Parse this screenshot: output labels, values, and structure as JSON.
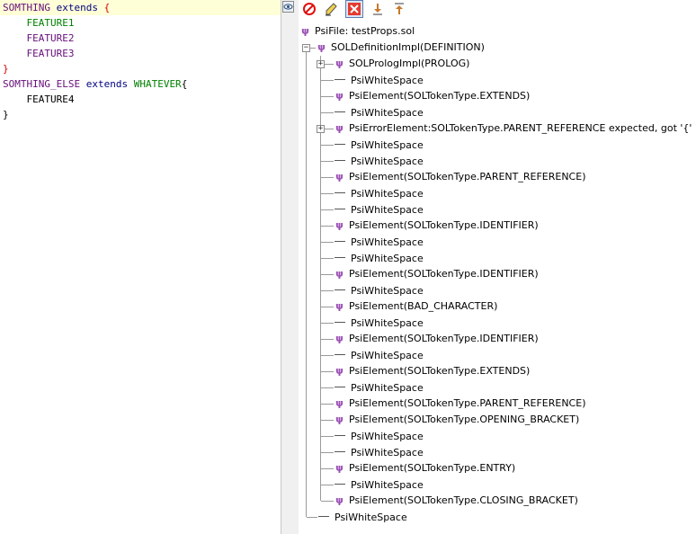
{
  "editor": {
    "lines": [
      [
        {
          "t": "SOMTHING ",
          "c": "t-const"
        },
        {
          "t": "extends",
          "c": "t-key"
        },
        {
          "t": " ",
          "c": "t-plain"
        },
        {
          "t": "{",
          "c": "t-brace-red"
        }
      ],
      [
        {
          "t": "    FEATURE1",
          "c": "t-feat-g"
        }
      ],
      [
        {
          "t": "    FEATURE2",
          "c": "t-feat"
        }
      ],
      [
        {
          "t": "    FEATURE3",
          "c": "t-feat"
        }
      ],
      [
        {
          "t": "}",
          "c": "t-brace-red"
        }
      ],
      [
        {
          "t": "SOMTHING_ELSE ",
          "c": "t-const"
        },
        {
          "t": "extends",
          "c": "t-key"
        },
        {
          "t": " ",
          "c": "t-plain"
        },
        {
          "t": "WHATEVER",
          "c": "t-green"
        },
        {
          "t": "{",
          "c": "t-plain"
        }
      ],
      [
        {
          "t": "    FEATURE4",
          "c": "t-plain"
        }
      ],
      [
        {
          "t": "}",
          "c": "t-plain"
        }
      ]
    ]
  },
  "toolbar": {
    "buttons": [
      {
        "name": "stop-button",
        "icon": "stop-icon"
      },
      {
        "name": "highlight-button",
        "icon": "highlighter-icon"
      },
      {
        "name": "clear-button",
        "icon": "close-icon",
        "active": true
      },
      {
        "name": "expand-all-button",
        "icon": "expand-all-icon"
      },
      {
        "name": "collapse-all-button",
        "icon": "collapse-all-icon"
      }
    ]
  },
  "tree": {
    "root": "PsiFile: testProps.sol",
    "definition": "SOLDefinitionImpl(DEFINITION)",
    "children": [
      {
        "label": "SOLPrologImpl(PROLOG)",
        "kind": "psi",
        "expandable": true
      },
      {
        "label": "PsiWhiteSpace",
        "kind": "ws"
      },
      {
        "label": "PsiElement(SOLTokenType.EXTENDS)",
        "kind": "psi"
      },
      {
        "label": "PsiWhiteSpace",
        "kind": "ws"
      },
      {
        "label": "PsiErrorElement:SOLTokenType.PARENT_REFERENCE expected, got '{'",
        "kind": "psi",
        "expandable": true
      },
      {
        "label": "PsiWhiteSpace",
        "kind": "ws"
      },
      {
        "label": "PsiWhiteSpace",
        "kind": "ws"
      },
      {
        "label": "PsiElement(SOLTokenType.PARENT_REFERENCE)",
        "kind": "psi"
      },
      {
        "label": "PsiWhiteSpace",
        "kind": "ws"
      },
      {
        "label": "PsiWhiteSpace",
        "kind": "ws"
      },
      {
        "label": "PsiElement(SOLTokenType.IDENTIFIER)",
        "kind": "psi"
      },
      {
        "label": "PsiWhiteSpace",
        "kind": "ws"
      },
      {
        "label": "PsiWhiteSpace",
        "kind": "ws"
      },
      {
        "label": "PsiElement(SOLTokenType.IDENTIFIER)",
        "kind": "psi"
      },
      {
        "label": "PsiWhiteSpace",
        "kind": "ws"
      },
      {
        "label": "PsiElement(BAD_CHARACTER)",
        "kind": "psi"
      },
      {
        "label": "PsiWhiteSpace",
        "kind": "ws"
      },
      {
        "label": "PsiElement(SOLTokenType.IDENTIFIER)",
        "kind": "psi"
      },
      {
        "label": "PsiWhiteSpace",
        "kind": "ws"
      },
      {
        "label": "PsiElement(SOLTokenType.EXTENDS)",
        "kind": "psi"
      },
      {
        "label": "PsiWhiteSpace",
        "kind": "ws"
      },
      {
        "label": "PsiElement(SOLTokenType.PARENT_REFERENCE)",
        "kind": "psi"
      },
      {
        "label": "PsiElement(SOLTokenType.OPENING_BRACKET)",
        "kind": "psi"
      },
      {
        "label": "PsiWhiteSpace",
        "kind": "ws"
      },
      {
        "label": "PsiWhiteSpace",
        "kind": "ws"
      },
      {
        "label": "PsiElement(SOLTokenType.ENTRY)",
        "kind": "psi"
      },
      {
        "label": "PsiWhiteSpace",
        "kind": "ws"
      },
      {
        "label": "PsiElement(SOLTokenType.CLOSING_BRACKET)",
        "kind": "psi"
      }
    ],
    "trailing": "PsiWhiteSpace"
  },
  "colors": {
    "psi_icon": "#9b4fb4",
    "current_line": "#ffffd7",
    "keyword": "#000080",
    "constant": "#660e7a",
    "brace": "#dd0000"
  }
}
